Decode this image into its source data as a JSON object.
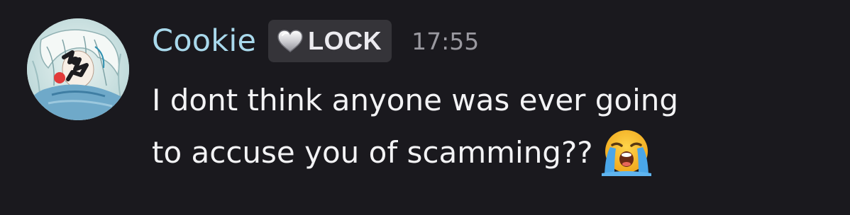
{
  "message": {
    "author": "Cookie",
    "tag": {
      "label": "LOCK",
      "icon": "heart-icon"
    },
    "timestamp": "17:55",
    "content": {
      "line1": "I dont think anyone was ever going",
      "line2": "to accuse you of scamming??",
      "emoji": "loudly-crying-face"
    }
  },
  "colors": {
    "background": "#1a191e",
    "username": "#a9d9ec",
    "tag_background": "#353439",
    "timestamp": "#9a99a0",
    "text": "#f3f3f5"
  }
}
